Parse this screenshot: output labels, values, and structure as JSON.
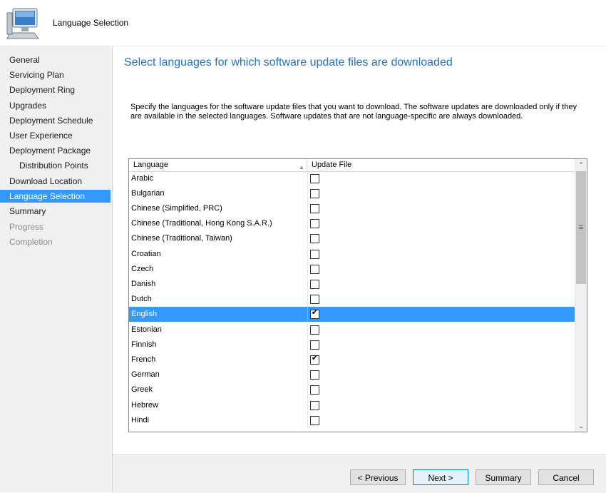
{
  "window": {
    "title": "Language Selection"
  },
  "sidebar": {
    "items": [
      {
        "label": "General",
        "state": "normal"
      },
      {
        "label": "Servicing Plan",
        "state": "normal"
      },
      {
        "label": "Deployment Ring",
        "state": "normal"
      },
      {
        "label": "Upgrades",
        "state": "normal"
      },
      {
        "label": "Deployment Schedule",
        "state": "normal"
      },
      {
        "label": "User Experience",
        "state": "normal"
      },
      {
        "label": "Deployment Package",
        "state": "normal"
      },
      {
        "label": "Distribution Points",
        "state": "normal",
        "indent": true
      },
      {
        "label": "Download Location",
        "state": "normal"
      },
      {
        "label": "Language Selection",
        "state": "selected"
      },
      {
        "label": "Summary",
        "state": "normal"
      },
      {
        "label": "Progress",
        "state": "disabled"
      },
      {
        "label": "Completion",
        "state": "disabled"
      }
    ]
  },
  "main": {
    "heading": "Select languages for which software update files are downloaded",
    "description": "Specify the languages for the software update files that you want to download. The software updates are downloaded only if they are available in the selected languages. Software updates that are not language-specific are always downloaded."
  },
  "grid": {
    "columns": {
      "language": "Language",
      "update_file": "Update File"
    },
    "rows": [
      {
        "language": "Arabic",
        "checked": false
      },
      {
        "language": "Bulgarian",
        "checked": false
      },
      {
        "language": "Chinese (Simplified, PRC)",
        "checked": false
      },
      {
        "language": "Chinese (Traditional, Hong Kong S.A.R.)",
        "checked": false
      },
      {
        "language": "Chinese (Traditional, Taiwan)",
        "checked": false
      },
      {
        "language": "Croatian",
        "checked": false
      },
      {
        "language": "Czech",
        "checked": false
      },
      {
        "language": "Danish",
        "checked": false
      },
      {
        "language": "Dutch",
        "checked": false
      },
      {
        "language": "English",
        "checked": true,
        "selected": true
      },
      {
        "language": "Estonian",
        "checked": false
      },
      {
        "language": "Finnish",
        "checked": false
      },
      {
        "language": "French",
        "checked": true
      },
      {
        "language": "German",
        "checked": false
      },
      {
        "language": "Greek",
        "checked": false
      },
      {
        "language": "Hebrew",
        "checked": false
      },
      {
        "language": "Hindi",
        "checked": false
      }
    ]
  },
  "buttons": {
    "previous": "< Previous",
    "next": "Next >",
    "summary": "Summary",
    "cancel": "Cancel"
  },
  "colors": {
    "selection": "#3399ff",
    "heading": "#1e72c4"
  }
}
